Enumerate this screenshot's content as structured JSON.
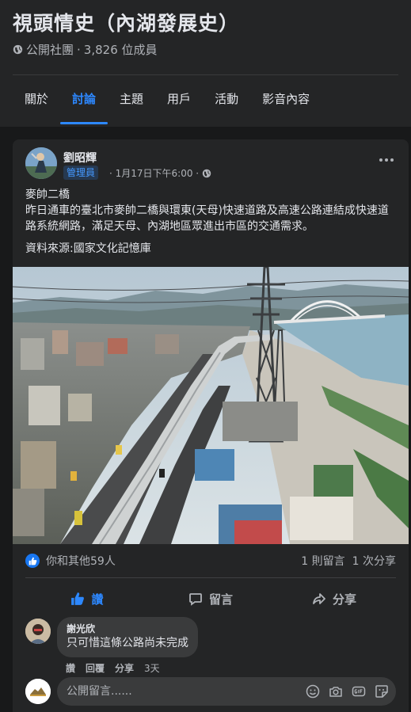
{
  "group": {
    "title": "視頭情史（內湖發展史）",
    "privacy": "公開社團",
    "separator": "·",
    "members": "3,826 位成員"
  },
  "tabs": [
    {
      "label": "關於"
    },
    {
      "label": "討論",
      "active": true
    },
    {
      "label": "主題"
    },
    {
      "label": "用戶"
    },
    {
      "label": "活動"
    },
    {
      "label": "影音內容"
    }
  ],
  "post": {
    "author": "劉昭輝",
    "badge": "管理員",
    "time": "· 1月17日下午6:00 ·",
    "text_title": "麥帥二橋",
    "text_body": "昨日通車的臺北市麥帥二橋與環東(天母)快速道路及高速公路連結成快速道路系統網路，滿足天母、內湖地區眾進出市區的交通需求。",
    "text_source": "資料來源:國家文化記憶庫",
    "reactions_text": "你和其他59人",
    "comments_count": "1 則留言",
    "shares_count": "1 次分享",
    "like_label": "讚",
    "comment_label": "留言",
    "share_label": "分享"
  },
  "comment": {
    "author": "謝光欣",
    "text": "只可惜這條公路尚未完成",
    "like": "讚",
    "reply": "回覆",
    "share": "分享",
    "age": "3天"
  },
  "composer": {
    "placeholder": "公開留言......"
  },
  "colors": {
    "background": "#18191a",
    "card": "#242526",
    "accent": "#2d88ff",
    "text": "#e4e6eb",
    "secondary": "#b0b3b8"
  }
}
